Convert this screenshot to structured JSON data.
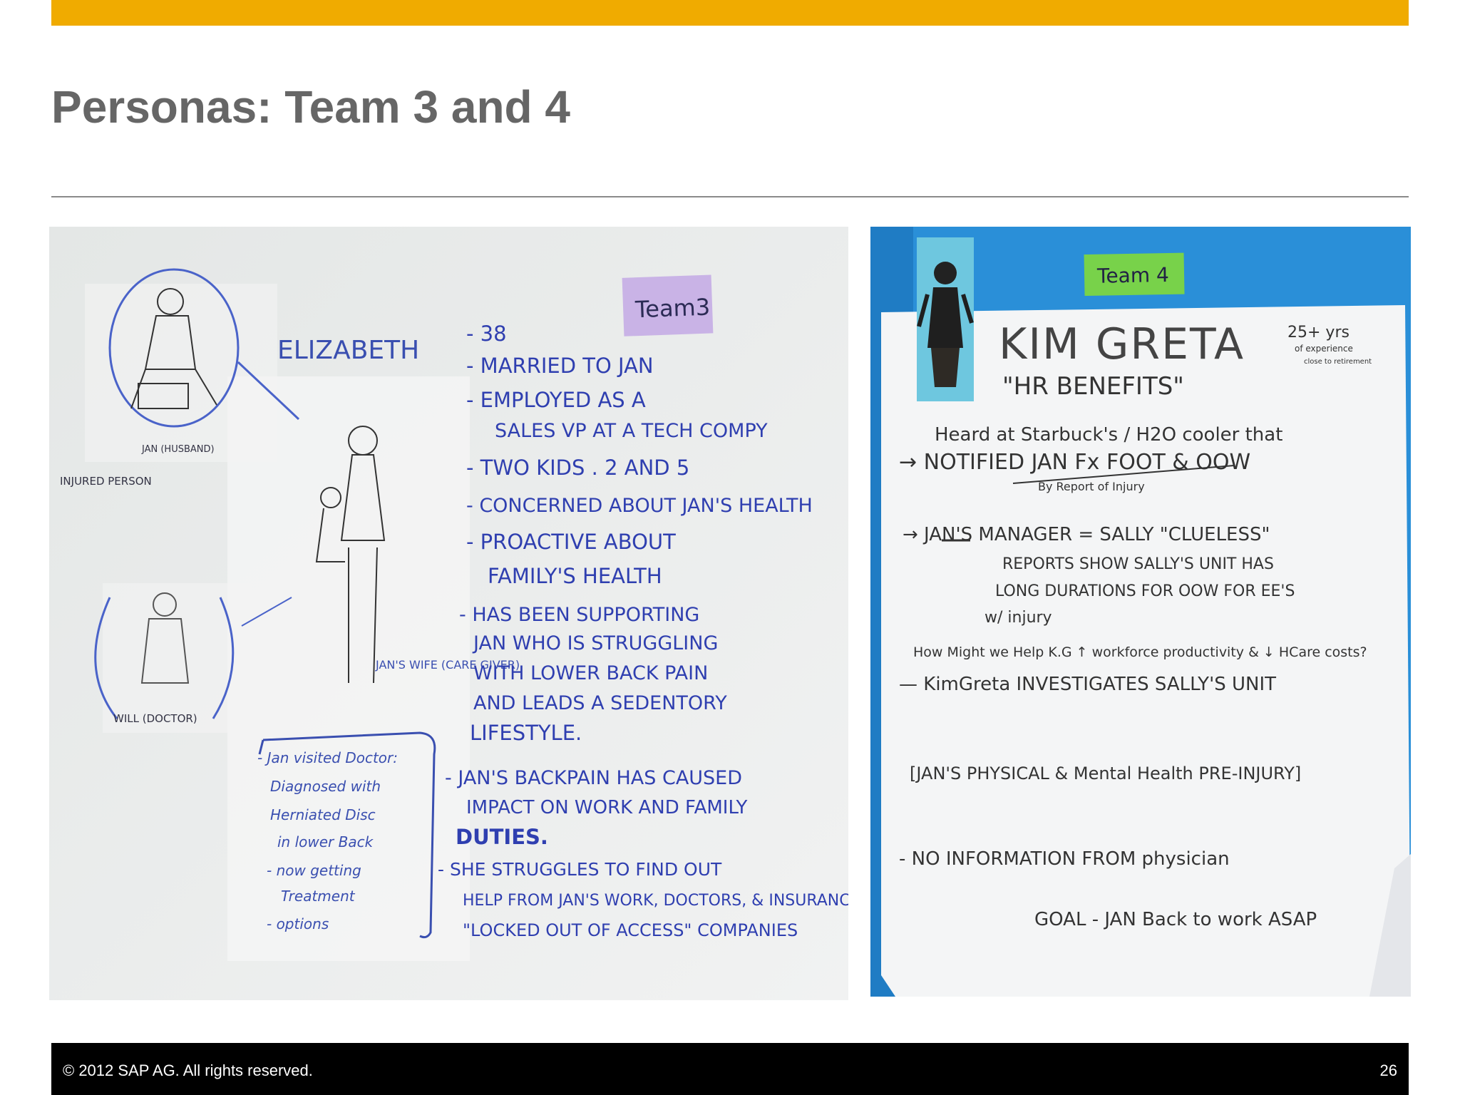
{
  "slide": {
    "title": "Personas: Team 3 and 4",
    "brand_color": "#f0ab00",
    "title_color": "#666666"
  },
  "team3_photo": {
    "tag": "Team3",
    "persona_name": "ELIZABETH",
    "sketch_labels": {
      "injured_person": "INJURED PERSON",
      "jan_husband": "JAN (HUSBAND)",
      "will_doctor": "WILL (DOCTOR)",
      "jans_wife": "JAN'S WIFE (CARE GIVER)"
    },
    "traits": [
      "- 38",
      "- MARRIED TO JAN",
      "- EMPLOYED AS A",
      "SALES VP AT A TECH COMPY",
      "- TWO KIDS . 2 AND 5",
      "- CONCERNED ABOUT JAN'S HEALTH",
      "- PROACTIVE ABOUT",
      "FAMILY'S HEALTH",
      "- HAS BEEN SUPPORTING",
      "JAN WHO IS STRUGGLING",
      "WITH LOWER BACK PAIN",
      "AND LEADS A SEDENTORY",
      "LIFESTYLE.",
      "- JAN'S BACKPAIN HAS CAUSED",
      "IMPACT ON WORK AND FAMILY",
      "DUTIES.",
      "- SHE STRUGGLES TO FIND OUT",
      "HELP FROM JAN'S WORK, DOCTORS, & INSURANCE",
      "\"LOCKED OUT OF ACCESS\" COMPANIES"
    ],
    "note": [
      "- Jan visited Doctor:",
      "Diagnosed with",
      "Herniated Disc",
      "in lower Back",
      "- now getting",
      "Treatment",
      "- options"
    ]
  },
  "team4_photo": {
    "tag": "Team 4",
    "persona_name": "KIM GRETA",
    "role": "\"HR BENEFITS\"",
    "experience": [
      "25+ yrs",
      "of experience",
      "close to retirement"
    ],
    "lines": [
      "Heard at Starbuck's / H2O cooler that",
      "→ NOTIFIED JAN Fx FOOT & OOW",
      "By Report of Injury",
      "→ JAN'S MANAGER = SALLY \"CLUELESS\"",
      "REPORTS SHOW SALLY'S UNIT HAS",
      "LONG DURATIONS FOR OOW FOR EE'S",
      "w/ injury",
      "How Might we Help K.G ↑ workforce productivity & ↓ HCare costs?",
      "— KimGreta INVESTIGATES SALLY'S UNIT",
      "[JAN'S PHYSICAL & Mental Health PRE-INJURY]",
      "- NO INFORMATION FROM physician",
      "GOAL - JAN Back to work ASAP"
    ]
  },
  "footer": {
    "copyright": "© 2012 SAP AG. All rights reserved.",
    "page_number": "26"
  }
}
